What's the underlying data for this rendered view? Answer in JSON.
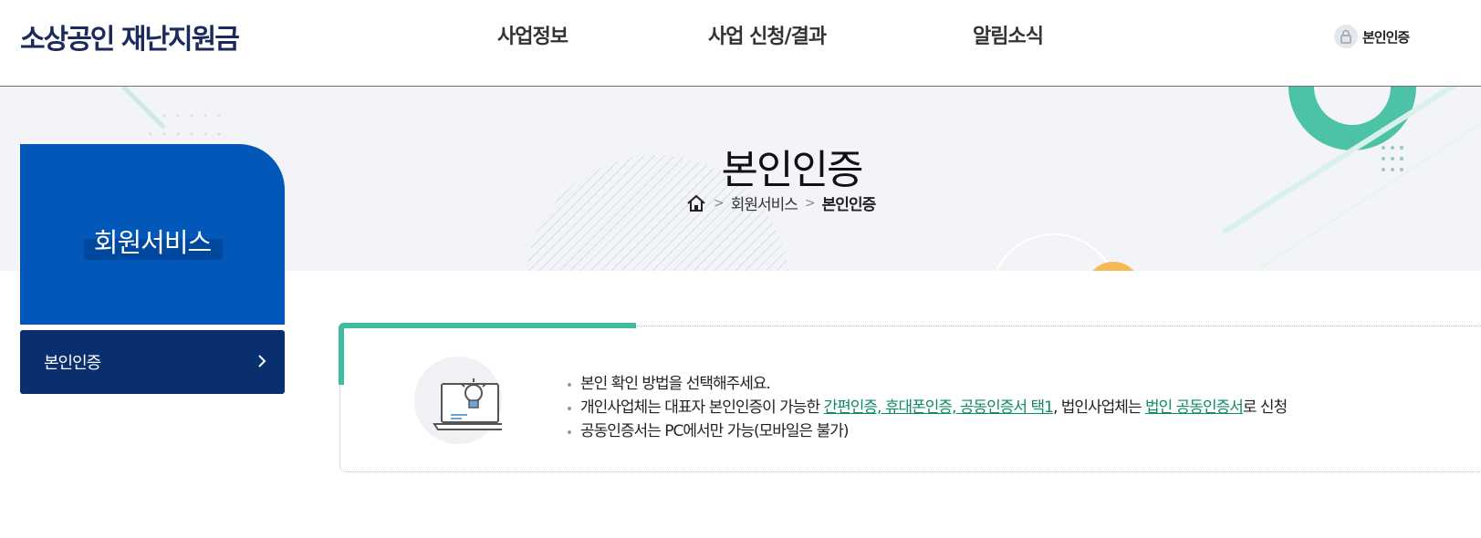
{
  "header": {
    "logo": "소상공인 재난지원금",
    "nav": [
      "사업정보",
      "사업 신청/결과",
      "알림소식"
    ],
    "auth_label": "본인인증"
  },
  "banner": {
    "title": "본인인증",
    "breadcrumb": [
      "회원서비스",
      "본인인증"
    ]
  },
  "sidebar": {
    "title": "회원서비스",
    "items": [
      {
        "label": "본인인증"
      }
    ]
  },
  "notice": {
    "line1": "본인 확인 방법을 선택해주세요.",
    "line2_prefix": "개인사업체는 대표자 본인인증이 가능한",
    "line2_link1": "간편인증, 휴대폰인증, 공동인증서 택1",
    "line2_middle": ", 법인사업체는",
    "line2_link2": "법인 공동인증서",
    "line2_suffix": "로 신청",
    "line3": "공동인증서는 PC에서만 가능(모바일은 불가)"
  },
  "colors": {
    "brand_navy": "#1b2a5c",
    "sidebar_blue": "#0158b8",
    "sidebar_item": "#0a2f6f",
    "accent_teal": "#3fbba0",
    "link_green": "#0f8a6a"
  },
  "icons": [
    "lock-icon",
    "home-icon",
    "chevron-right-icon",
    "lightbulb-laptop-icon"
  ]
}
